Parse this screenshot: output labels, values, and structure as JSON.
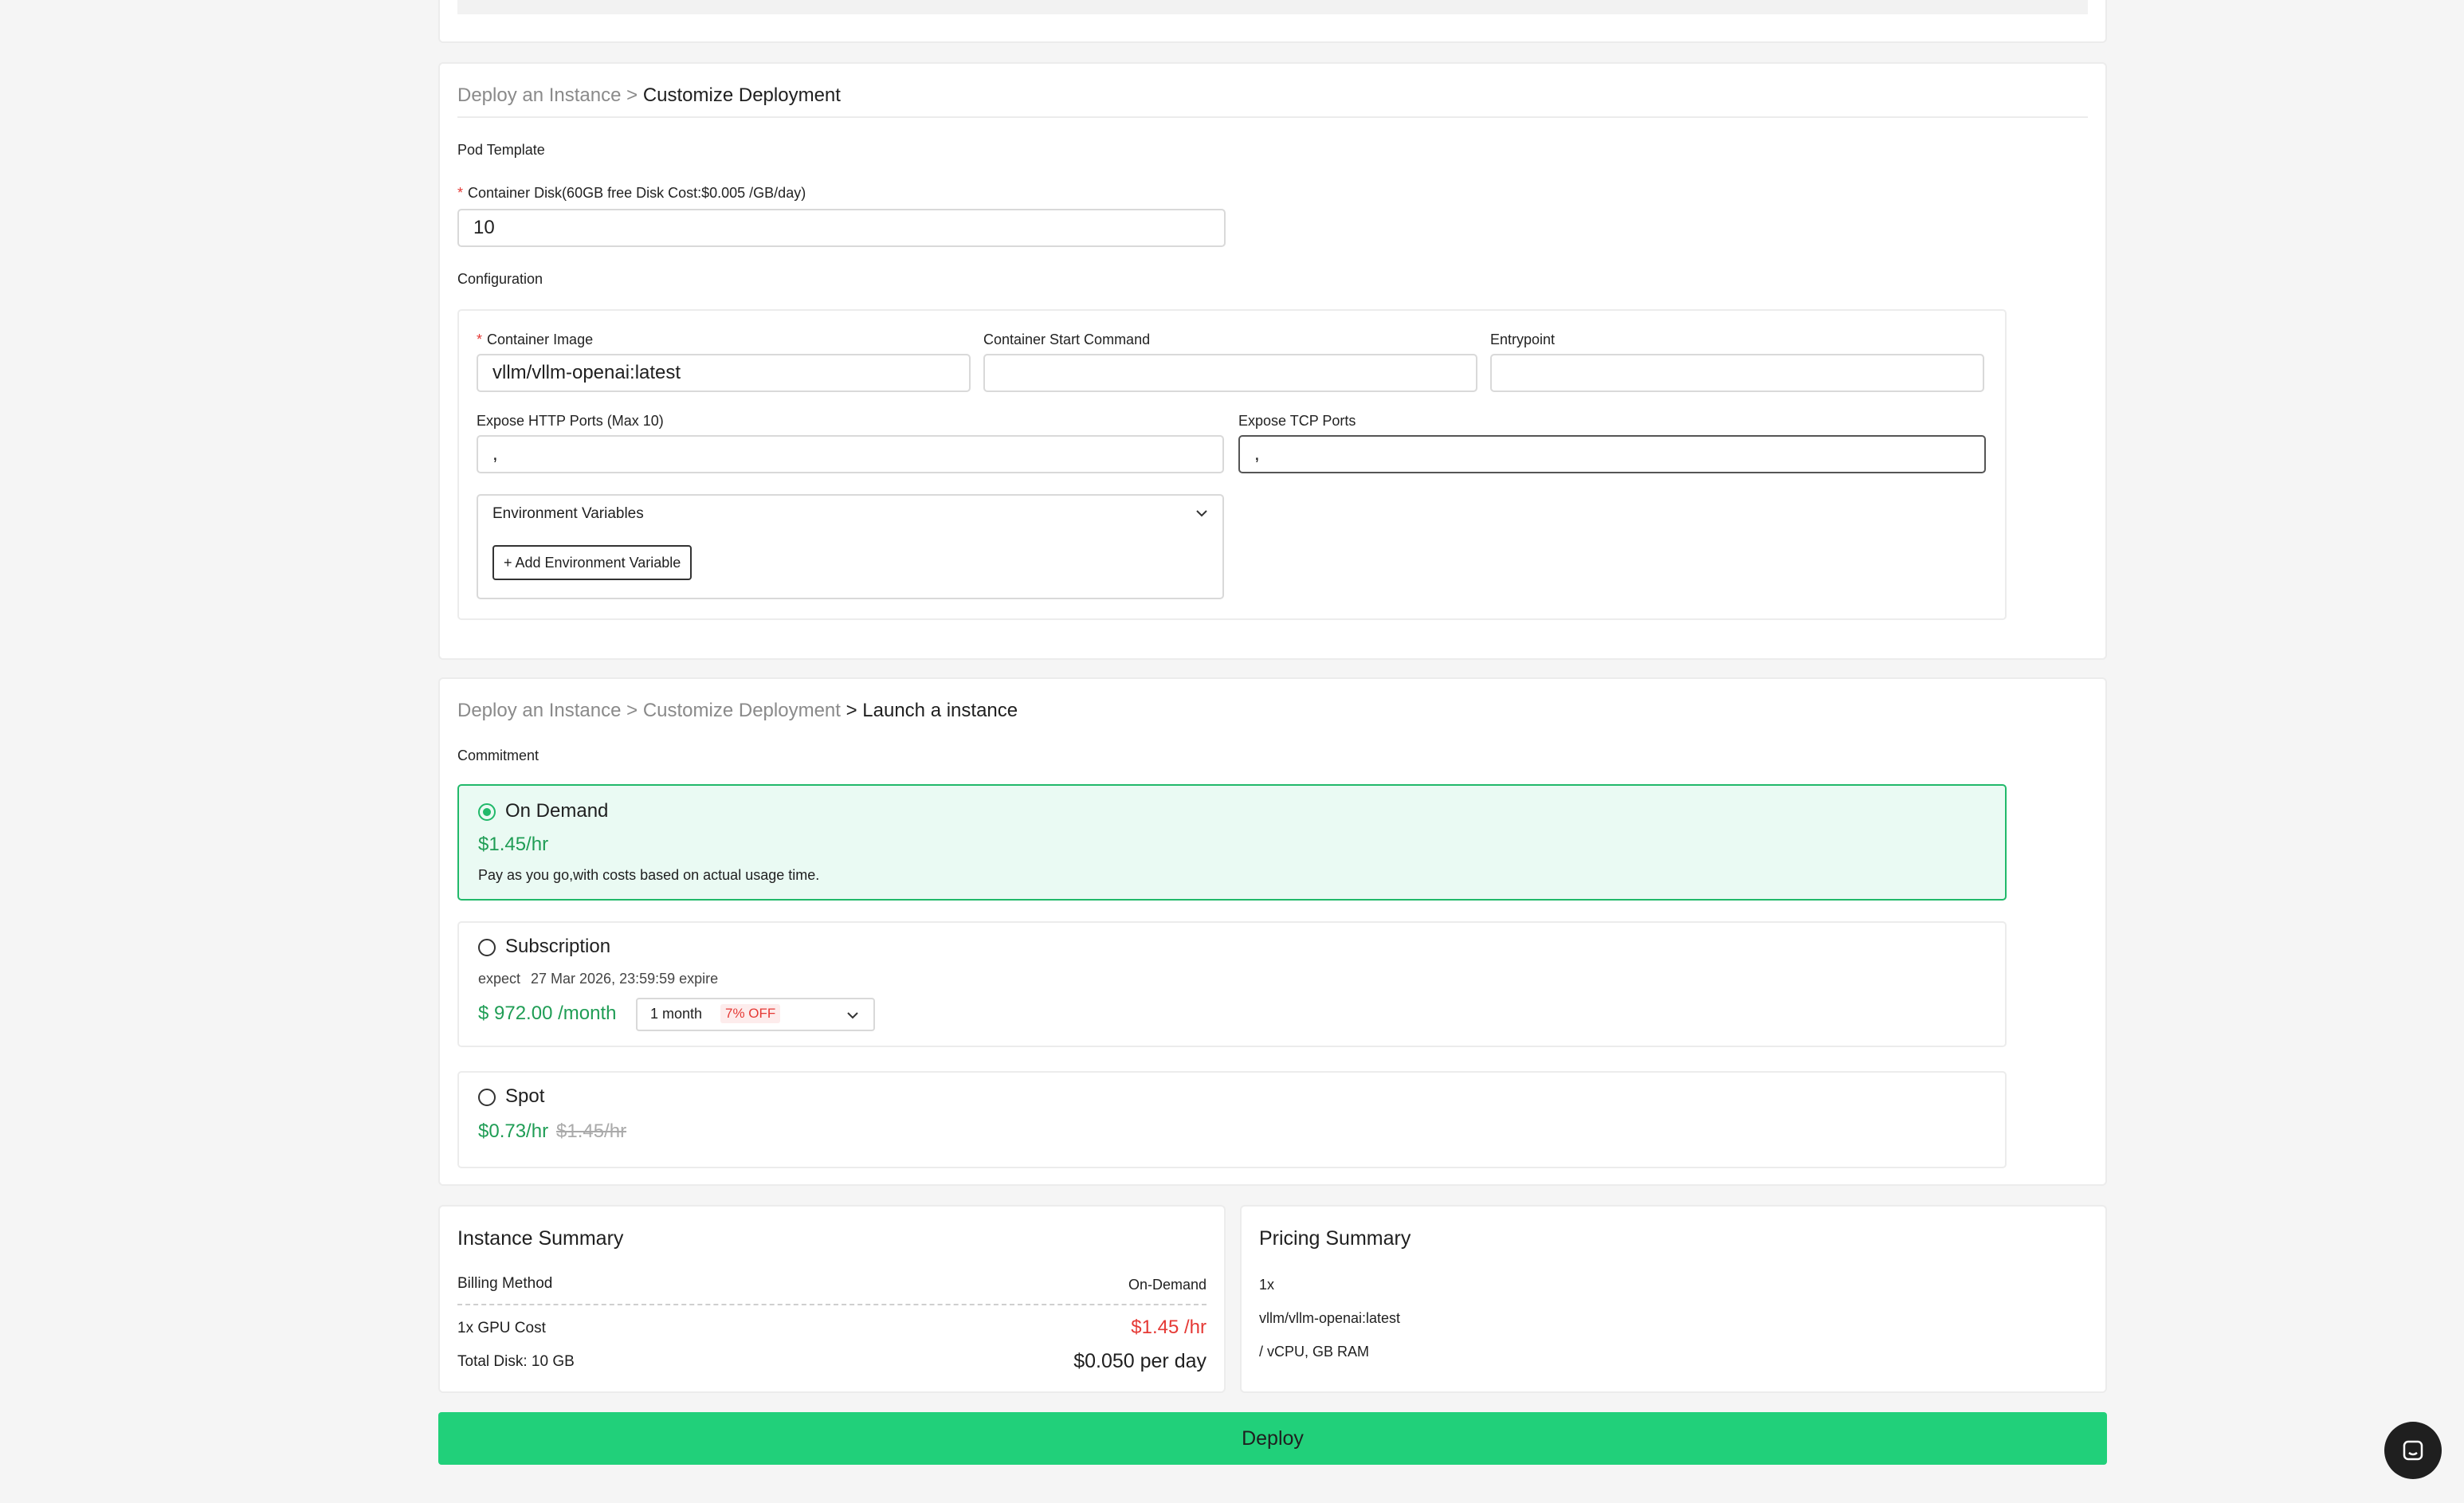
{
  "customize": {
    "breadcrumb_root": "Deploy an Instance",
    "breadcrumb_sep": ">",
    "breadcrumb_current": "Customize Deployment",
    "pod_template_label": "Pod Template",
    "container_disk_label": "Container Disk(60GB free Disk Cost:$0.005 /GB/day)",
    "container_disk_value": "10",
    "configuration_label": "Configuration",
    "container_image_label": "Container Image",
    "container_image_value": "vllm/vllm-openai:latest",
    "start_command_label": "Container Start Command",
    "start_command_value": "",
    "entrypoint_label": "Entrypoint",
    "entrypoint_value": "",
    "http_ports_label": "Expose HTTP Ports (Max 10)",
    "http_ports_value": ",",
    "tcp_ports_label": "Expose TCP Ports",
    "tcp_ports_value": ",",
    "env_vars_label": "Environment Variables",
    "add_env_button": "+ Add Environment Variable"
  },
  "launch": {
    "breadcrumb_root": "Deploy an Instance",
    "breadcrumb_sep1": ">",
    "breadcrumb_mid": "Customize Deployment",
    "breadcrumb_current": "> Launch a instance",
    "commitment_label": "Commitment",
    "on_demand": {
      "title": "On Demand",
      "price": "$1.45/hr",
      "description": "Pay as you go,with costs based on actual usage time.",
      "selected": true
    },
    "subscription": {
      "title": "Subscription",
      "expect_label": "expect",
      "expire_date": "27 Mar 2026, 23:59:59 expire",
      "price": "$ 972.00 /month",
      "duration_selected": "1 month",
      "discount_badge": "7% OFF",
      "selected": false
    },
    "spot": {
      "title": "Spot",
      "price": "$0.73/hr",
      "original_price": "$1.45/hr",
      "selected": false
    }
  },
  "instance_summary": {
    "title": "Instance Summary",
    "billing_method_label": "Billing Method",
    "billing_method_value": "On-Demand",
    "gpu_cost_label": "1x GPU Cost",
    "gpu_cost_value": "$1.45 /hr",
    "total_disk_label": "Total Disk: 10 GB",
    "total_disk_value": "$0.050 per day"
  },
  "pricing_summary": {
    "title": "Pricing Summary",
    "line1": "1x",
    "line2": "vllm/vllm-openai:latest",
    "line3": "/ vCPU, GB RAM"
  },
  "deploy_button": "Deploy",
  "colors": {
    "accent_green": "#21d07a",
    "price_green": "#1f9d55",
    "price_red": "#e53935",
    "selected_bg": "#eafaf3"
  }
}
